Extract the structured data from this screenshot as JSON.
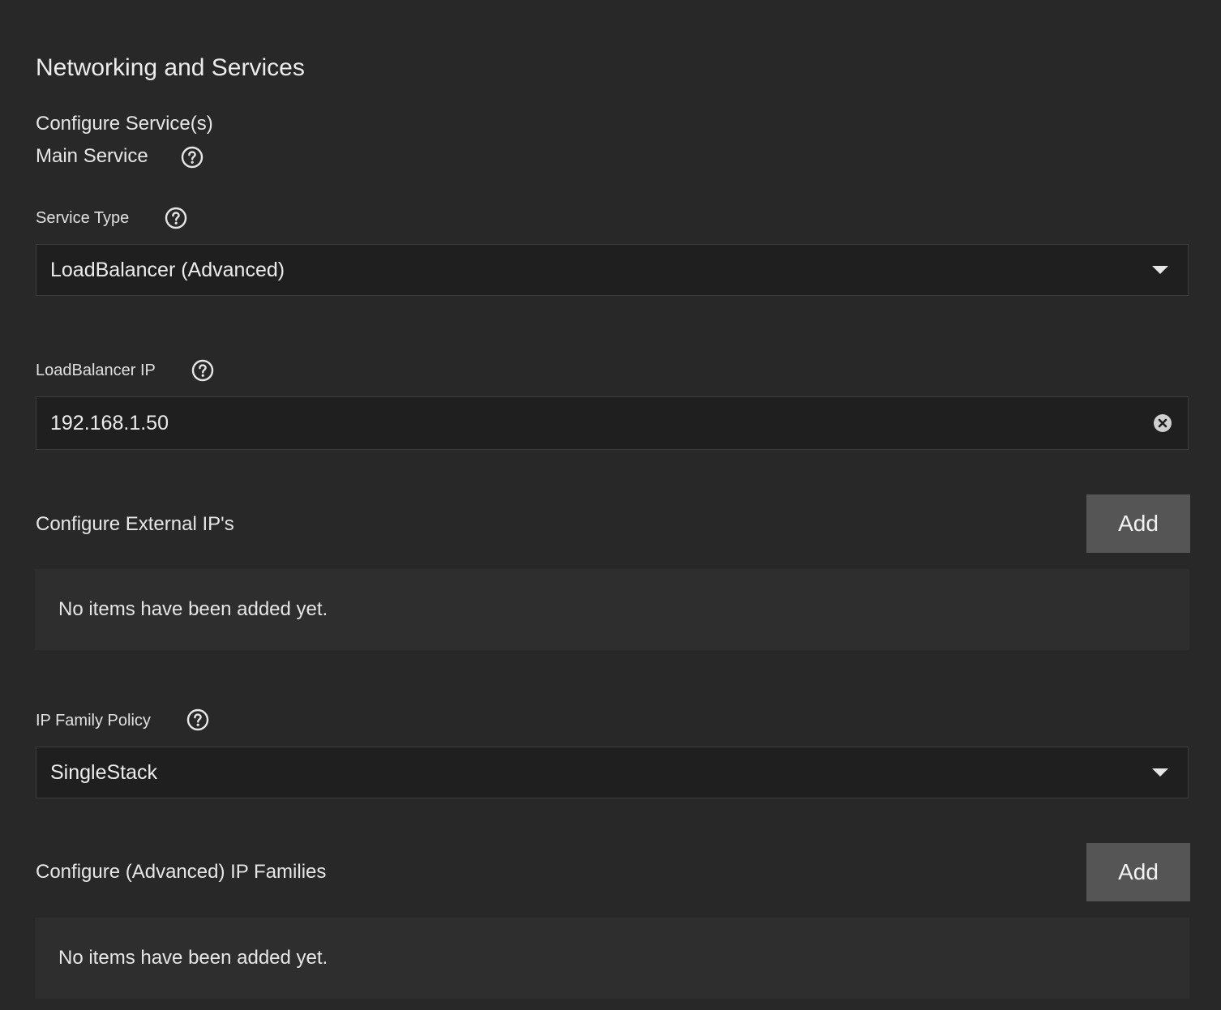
{
  "section": {
    "title": "Networking and Services",
    "configure_services": "Configure Service(s)",
    "main_service": "Main Service"
  },
  "service_type": {
    "label": "Service Type",
    "value": "LoadBalancer (Advanced)"
  },
  "loadbalancer_ip": {
    "label": "LoadBalancer IP",
    "value": "192.168.1.50"
  },
  "external_ips": {
    "label": "Configure External IP's",
    "add_label": "Add",
    "empty_text": "No items have been added yet."
  },
  "ip_family_policy": {
    "label": "IP Family Policy",
    "value": "SingleStack"
  },
  "ip_families": {
    "label": "Configure (Advanced) IP Families",
    "add_label": "Add",
    "empty_text": "No items have been added yet."
  },
  "icons": {
    "help": "help-circle-icon",
    "dropdown": "caret-down-icon",
    "clear": "clear-circle-icon"
  },
  "colors": {
    "background": "#282828",
    "field_background": "#1f1f1f",
    "button_background": "#555555",
    "panel_background": "#2e2e2e",
    "text": "#e8e8e8"
  }
}
